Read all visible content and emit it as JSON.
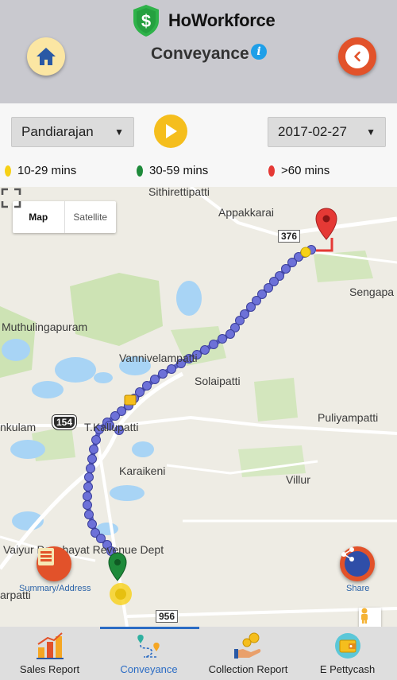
{
  "app": {
    "name": "HoWorkforce",
    "screen_title": "Conveyance"
  },
  "controls": {
    "user_select": {
      "value": "Pandiarajan"
    },
    "date_select": {
      "value": "2017-02-27"
    }
  },
  "legend": [
    {
      "label": "10-29 mins",
      "color": "#f7d117"
    },
    {
      "label": "30-59 mins",
      "color": "#1e8a3a"
    },
    {
      "label": ">60 mins",
      "color": "#e53935"
    }
  ],
  "map": {
    "type_control": {
      "map": "Map",
      "satellite": "Satellite"
    },
    "places": {
      "sithirettipatti": "Sithirettipatti",
      "appakkarai": "Appakkarai",
      "sengapa": "Sengapa",
      "muthulingapuram": "Muthulingapuram",
      "vannivelampatti": "Vannivelampatti",
      "solaipatti": "Solaipatti",
      "puliyampatti": "Puliyampatti",
      "nkulam": "nkulam",
      "t_kallupatti": "T.Kallupatti",
      "karaikeni": "Karaikeni",
      "villur": "Villur",
      "vaiyur": "Vaiyur Panchayat Revenue Dept",
      "arpatti": "arpatti"
    },
    "road_numbers": {
      "r376": "376",
      "r154": "154",
      "r956": "956"
    },
    "actions": {
      "summary_label": "Summary/Address",
      "share_label": "Share"
    }
  },
  "bottom_nav": [
    {
      "label": "Sales Report"
    },
    {
      "label": "Conveyance"
    },
    {
      "label": "Collection Report"
    },
    {
      "label": "E Pettycash"
    }
  ]
}
